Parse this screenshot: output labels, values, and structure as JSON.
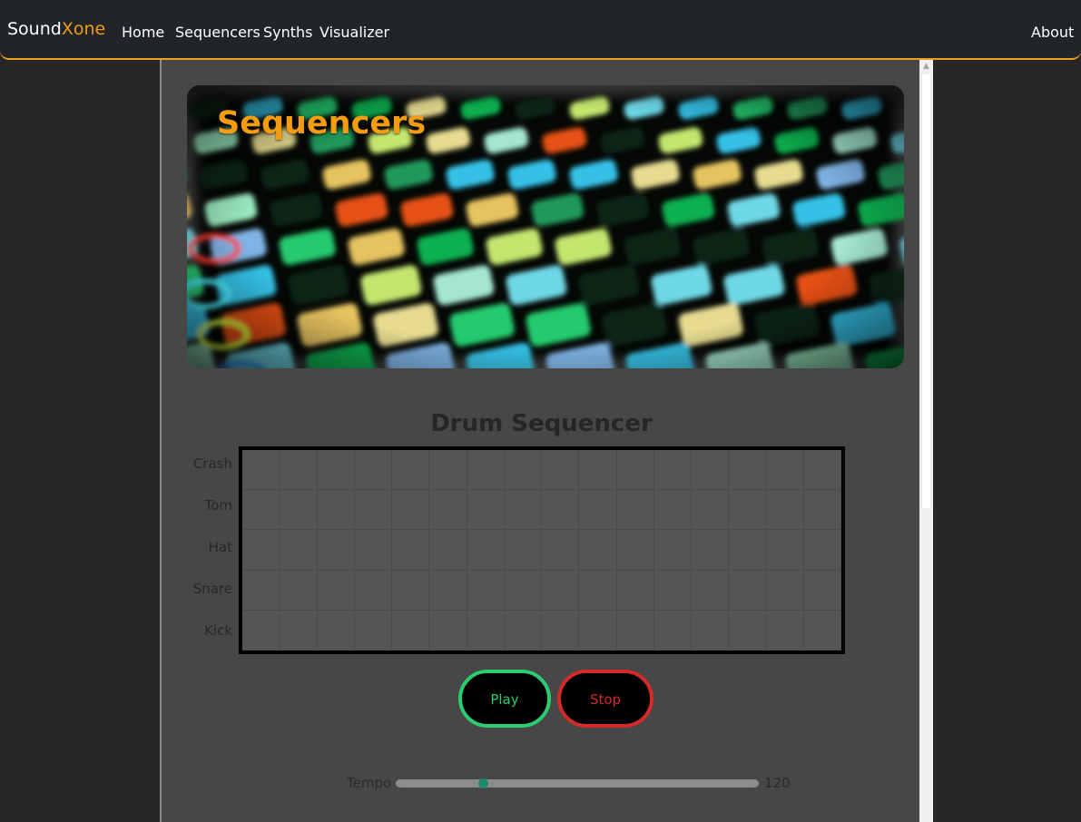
{
  "nav": {
    "brand_part1": "Sound",
    "brand_part2": "Xone",
    "links": [
      "Home",
      "Sequencers",
      "Synths",
      "Visualizer"
    ],
    "about": "About"
  },
  "hero": {
    "title": "Sequencers"
  },
  "sequencer": {
    "title": "Drum Sequencer",
    "rows": [
      "Crash",
      "Tom",
      "Hat",
      "Snare",
      "Kick"
    ],
    "steps": 16,
    "play_label": "Play",
    "stop_label": "Stop"
  },
  "tempo": {
    "label": "Tempo",
    "value": "120",
    "position": 0.24
  },
  "colors": {
    "accent": "#f39c12",
    "play": "#2ecc71",
    "stop": "#d42a2a",
    "slider_thumb": "#1f8a6b"
  }
}
